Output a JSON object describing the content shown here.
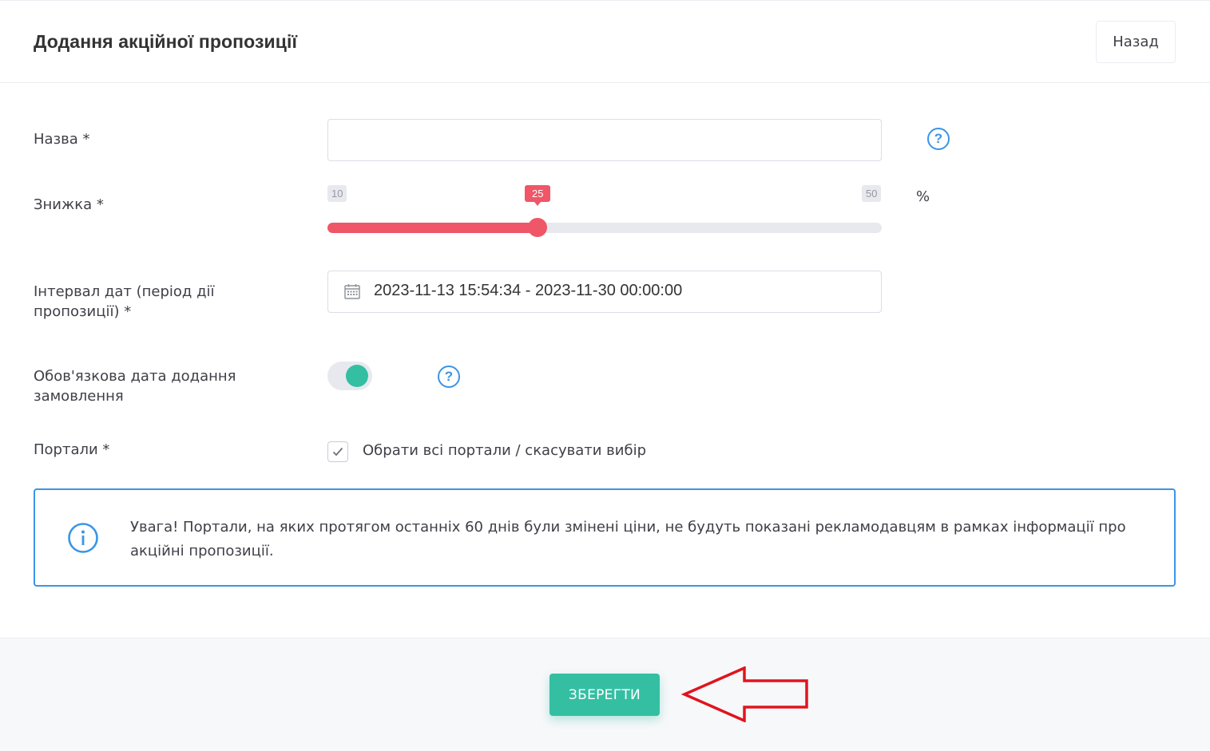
{
  "header": {
    "title": "Додання акційної пропозиції",
    "back_label": "Назад"
  },
  "form": {
    "name": {
      "label": "Назва *",
      "value": "",
      "help_icon": "question-circle-icon"
    },
    "discount": {
      "label": "Знижка *",
      "min": 10,
      "max": 50,
      "value": 25,
      "min_label": "10",
      "max_label": "50",
      "value_label": "25",
      "unit": "%"
    },
    "date_range": {
      "label": "Інтервал дат (період дії пропозиції) *",
      "value": "2023-11-13 15:54:34 - 2023-11-30 00:00:00",
      "icon": "calendar-icon"
    },
    "required_order_date": {
      "label": "Обов'язкова дата додання замовлення",
      "enabled": true,
      "help_icon": "question-circle-icon"
    },
    "portals": {
      "label": "Портали *",
      "checkbox_label": "Обрати всі портали / скасувати вибір",
      "checked": true
    }
  },
  "alert": {
    "icon": "info-circle-icon",
    "text": "Увага! Портали, на яких протягом останніх 60 днів були змінені ціни, не будуть показані рекламодавцям в рамках інформації про акційні пропозиції."
  },
  "footer": {
    "save_label": "ЗБЕРЕГТИ",
    "annotation": "red-arrow-icon"
  },
  "colors": {
    "accent": "#34bfa3",
    "slider": "#ef5667",
    "info": "#3a95e6",
    "annotation": "#e0141e"
  }
}
